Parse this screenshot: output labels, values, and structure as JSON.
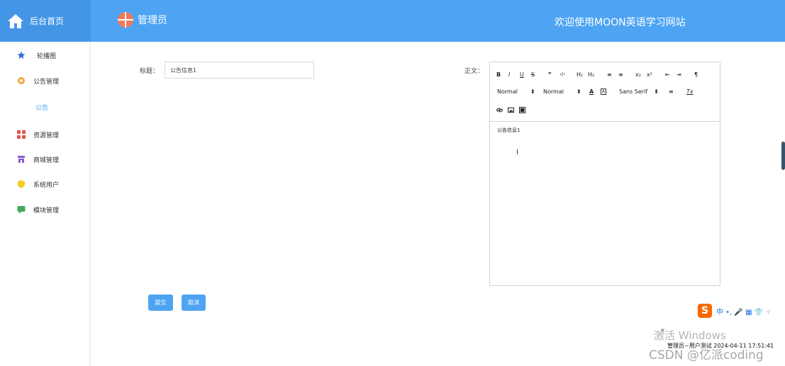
{
  "header": {
    "home_label": "后台首页",
    "admin_name": "管理员",
    "welcome": "欢迎使用MOON英语学习网站",
    "bg_color": "#4ea4f2"
  },
  "sidebar": {
    "items": [
      {
        "label": "轮播图",
        "icon": "star-icon"
      },
      {
        "label": "公告管理",
        "icon": "gear-icon"
      },
      {
        "label": "公告",
        "icon": ""
      },
      {
        "label": "资源管理",
        "icon": "grid-icon"
      },
      {
        "label": "商城管理",
        "icon": "store-icon"
      },
      {
        "label": "系统用户",
        "icon": "shield-icon"
      },
      {
        "label": "模块管理",
        "icon": "chat-icon"
      }
    ]
  },
  "form": {
    "title_label": "标题：",
    "title_value": "公告信息1",
    "body_label": "正文：",
    "body_content": "公告信息1",
    "submit": "提交",
    "cancel": "取消"
  },
  "editor": {
    "toolbar_row1": [
      "B",
      "I",
      "U",
      "S",
      "❞",
      "‹/›",
      "H₁",
      "H₂",
      "≡",
      "≡",
      "x₂",
      "x²",
      "⇤",
      "⇥",
      "¶"
    ],
    "header_select": "Normal",
    "size_select": "Normal",
    "font_select": "Sans Serif",
    "clear_format": "Tx"
  },
  "tray": {
    "ime_logo": "S",
    "ime_text": "中 •, 🎤 ▦ 👕 ⁘",
    "watermark": "激活 Windows",
    "status": "管理员~用户测试 2024-04-11 17:51:41",
    "csdn": "CSDN @亿派coding"
  }
}
